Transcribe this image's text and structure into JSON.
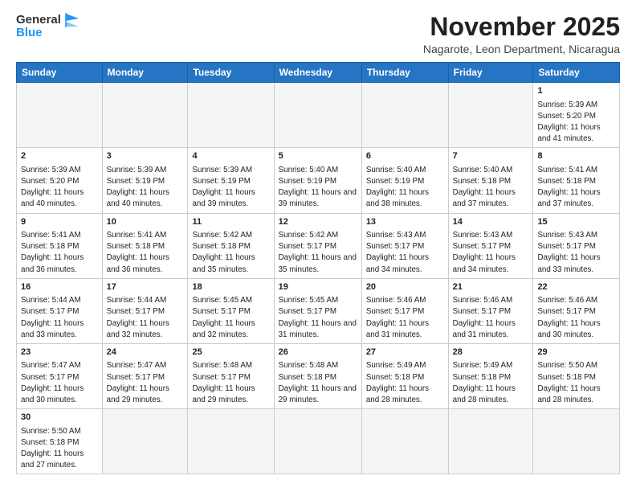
{
  "header": {
    "logo_general": "General",
    "logo_blue": "Blue",
    "month_year": "November 2025",
    "location": "Nagarote, Leon Department, Nicaragua"
  },
  "weekdays": [
    "Sunday",
    "Monday",
    "Tuesday",
    "Wednesday",
    "Thursday",
    "Friday",
    "Saturday"
  ],
  "weeks": [
    [
      {
        "day": "",
        "info": ""
      },
      {
        "day": "",
        "info": ""
      },
      {
        "day": "",
        "info": ""
      },
      {
        "day": "",
        "info": ""
      },
      {
        "day": "",
        "info": ""
      },
      {
        "day": "",
        "info": ""
      },
      {
        "day": "1",
        "info": "Sunrise: 5:39 AM\nSunset: 5:20 PM\nDaylight: 11 hours\nand 41 minutes."
      }
    ],
    [
      {
        "day": "2",
        "info": "Sunrise: 5:39 AM\nSunset: 5:20 PM\nDaylight: 11 hours\nand 40 minutes."
      },
      {
        "day": "3",
        "info": "Sunrise: 5:39 AM\nSunset: 5:19 PM\nDaylight: 11 hours\nand 40 minutes."
      },
      {
        "day": "4",
        "info": "Sunrise: 5:39 AM\nSunset: 5:19 PM\nDaylight: 11 hours\nand 39 minutes."
      },
      {
        "day": "5",
        "info": "Sunrise: 5:40 AM\nSunset: 5:19 PM\nDaylight: 11 hours\nand 39 minutes."
      },
      {
        "day": "6",
        "info": "Sunrise: 5:40 AM\nSunset: 5:19 PM\nDaylight: 11 hours\nand 38 minutes."
      },
      {
        "day": "7",
        "info": "Sunrise: 5:40 AM\nSunset: 5:18 PM\nDaylight: 11 hours\nand 37 minutes."
      },
      {
        "day": "8",
        "info": "Sunrise: 5:41 AM\nSunset: 5:18 PM\nDaylight: 11 hours\nand 37 minutes."
      }
    ],
    [
      {
        "day": "9",
        "info": "Sunrise: 5:41 AM\nSunset: 5:18 PM\nDaylight: 11 hours\nand 36 minutes."
      },
      {
        "day": "10",
        "info": "Sunrise: 5:41 AM\nSunset: 5:18 PM\nDaylight: 11 hours\nand 36 minutes."
      },
      {
        "day": "11",
        "info": "Sunrise: 5:42 AM\nSunset: 5:18 PM\nDaylight: 11 hours\nand 35 minutes."
      },
      {
        "day": "12",
        "info": "Sunrise: 5:42 AM\nSunset: 5:17 PM\nDaylight: 11 hours\nand 35 minutes."
      },
      {
        "day": "13",
        "info": "Sunrise: 5:43 AM\nSunset: 5:17 PM\nDaylight: 11 hours\nand 34 minutes."
      },
      {
        "day": "14",
        "info": "Sunrise: 5:43 AM\nSunset: 5:17 PM\nDaylight: 11 hours\nand 34 minutes."
      },
      {
        "day": "15",
        "info": "Sunrise: 5:43 AM\nSunset: 5:17 PM\nDaylight: 11 hours\nand 33 minutes."
      }
    ],
    [
      {
        "day": "16",
        "info": "Sunrise: 5:44 AM\nSunset: 5:17 PM\nDaylight: 11 hours\nand 33 minutes."
      },
      {
        "day": "17",
        "info": "Sunrise: 5:44 AM\nSunset: 5:17 PM\nDaylight: 11 hours\nand 32 minutes."
      },
      {
        "day": "18",
        "info": "Sunrise: 5:45 AM\nSunset: 5:17 PM\nDaylight: 11 hours\nand 32 minutes."
      },
      {
        "day": "19",
        "info": "Sunrise: 5:45 AM\nSunset: 5:17 PM\nDaylight: 11 hours\nand 31 minutes."
      },
      {
        "day": "20",
        "info": "Sunrise: 5:46 AM\nSunset: 5:17 PM\nDaylight: 11 hours\nand 31 minutes."
      },
      {
        "day": "21",
        "info": "Sunrise: 5:46 AM\nSunset: 5:17 PM\nDaylight: 11 hours\nand 31 minutes."
      },
      {
        "day": "22",
        "info": "Sunrise: 5:46 AM\nSunset: 5:17 PM\nDaylight: 11 hours\nand 30 minutes."
      }
    ],
    [
      {
        "day": "23",
        "info": "Sunrise: 5:47 AM\nSunset: 5:17 PM\nDaylight: 11 hours\nand 30 minutes."
      },
      {
        "day": "24",
        "info": "Sunrise: 5:47 AM\nSunset: 5:17 PM\nDaylight: 11 hours\nand 29 minutes."
      },
      {
        "day": "25",
        "info": "Sunrise: 5:48 AM\nSunset: 5:17 PM\nDaylight: 11 hours\nand 29 minutes."
      },
      {
        "day": "26",
        "info": "Sunrise: 5:48 AM\nSunset: 5:18 PM\nDaylight: 11 hours\nand 29 minutes."
      },
      {
        "day": "27",
        "info": "Sunrise: 5:49 AM\nSunset: 5:18 PM\nDaylight: 11 hours\nand 28 minutes."
      },
      {
        "day": "28",
        "info": "Sunrise: 5:49 AM\nSunset: 5:18 PM\nDaylight: 11 hours\nand 28 minutes."
      },
      {
        "day": "29",
        "info": "Sunrise: 5:50 AM\nSunset: 5:18 PM\nDaylight: 11 hours\nand 28 minutes."
      }
    ],
    [
      {
        "day": "30",
        "info": "Sunrise: 5:50 AM\nSunset: 5:18 PM\nDaylight: 11 hours\nand 27 minutes."
      },
      {
        "day": "",
        "info": ""
      },
      {
        "day": "",
        "info": ""
      },
      {
        "day": "",
        "info": ""
      },
      {
        "day": "",
        "info": ""
      },
      {
        "day": "",
        "info": ""
      },
      {
        "day": "",
        "info": ""
      }
    ]
  ]
}
